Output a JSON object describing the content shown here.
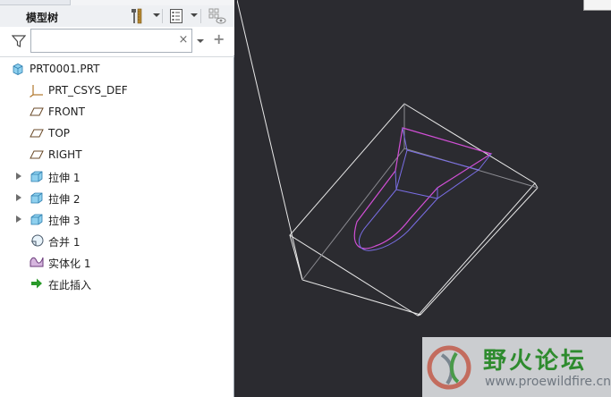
{
  "panel": {
    "title": "模型树",
    "search": {
      "value": "",
      "placeholder": ""
    },
    "clear_symbol": "×",
    "add_symbol": "+"
  },
  "tree": {
    "items": [
      {
        "label": "PRT0001.PRT",
        "icon": "part-icon",
        "expandable": false
      },
      {
        "label": "PRT_CSYS_DEF",
        "icon": "csys-icon",
        "expandable": false
      },
      {
        "label": "FRONT",
        "icon": "datum-plane-icon",
        "expandable": false
      },
      {
        "label": "TOP",
        "icon": "datum-plane-icon",
        "expandable": false
      },
      {
        "label": "RIGHT",
        "icon": "datum-plane-icon",
        "expandable": false
      },
      {
        "label": "拉伸 1",
        "icon": "extrude-icon",
        "expandable": true
      },
      {
        "label": "拉伸 2",
        "icon": "extrude-icon",
        "expandable": true
      },
      {
        "label": "拉伸 3",
        "icon": "extrude-icon",
        "expandable": true
      },
      {
        "label": "合并 1",
        "icon": "merge-icon",
        "expandable": false
      },
      {
        "label": "实体化 1",
        "icon": "solidify-icon",
        "expandable": false
      },
      {
        "label": "在此插入",
        "icon": "insert-here-arrow-icon",
        "expandable": false
      }
    ]
  },
  "watermark": {
    "name": "野火论坛",
    "url": "www.proewildfire.cn"
  },
  "colors": {
    "viewport_bg": "#2b2b30",
    "wire_white": "#e8e8e8",
    "wire_magenta": "#d24fd6",
    "wire_blue": "#7a6ee6",
    "insert_arrow": "#2a9a2a",
    "watermark_green": "#2e8b2e"
  }
}
